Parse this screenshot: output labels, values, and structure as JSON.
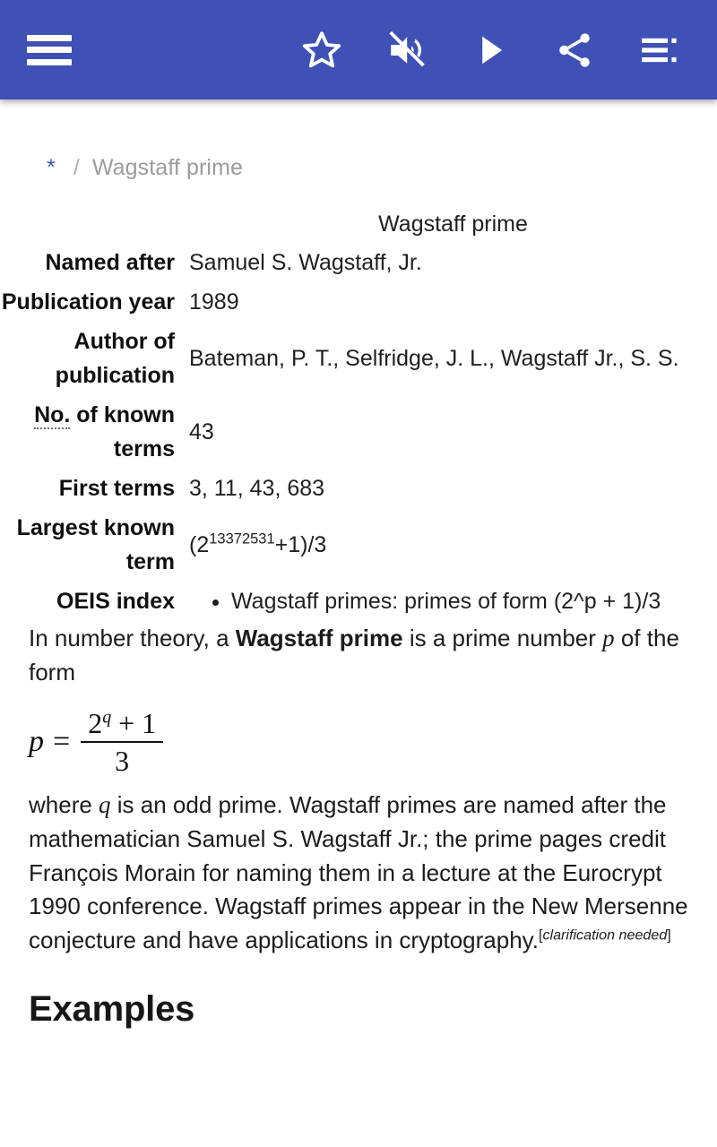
{
  "appbar": {
    "background_color": "#3f51b5",
    "menu_icon": "hamburger-menu-icon",
    "actions": [
      {
        "name": "favorite",
        "icon": "star-outline-icon",
        "label": "Favorite"
      },
      {
        "name": "mute",
        "icon": "volume-off-icon",
        "label": "Volume off"
      },
      {
        "name": "play",
        "icon": "play-icon",
        "label": "Play"
      },
      {
        "name": "share",
        "icon": "share-icon",
        "label": "Share"
      },
      {
        "name": "contents",
        "icon": "table-of-contents-icon",
        "label": "Contents"
      }
    ]
  },
  "breadcrumb": {
    "home": "*",
    "separator": "/",
    "current": "Wagstaff prime"
  },
  "infobox": {
    "title": "Wagstaff prime",
    "rows": [
      {
        "label": "Named after",
        "value": "Samuel S. Wagstaff, Jr."
      },
      {
        "label": "Publication year",
        "value": "1989"
      },
      {
        "label": "Author of publication",
        "value": "Bateman, P. T., Selfridge, J. L., Wagstaff Jr., S. S."
      },
      {
        "label_abbr": "No.",
        "label_rest": " of known terms",
        "label": "No. of known terms",
        "value": "43"
      },
      {
        "label": "First terms",
        "value": "3, 11, 43, 683"
      },
      {
        "label": "Largest known term",
        "value_pre": "(2",
        "value_sup": "13372531",
        "value_post": "+1)/3",
        "value": "(2^13372531+1)/3"
      },
      {
        "label": "OEIS index",
        "value": "Wagstaff primes: primes of form (2^p + 1)/3"
      }
    ]
  },
  "article": {
    "intro_1": "In number theory, a ",
    "intro_bold": "Wagstaff prime",
    "intro_2": " is a prime number ",
    "intro_var": "p",
    "intro_3": " of the form",
    "formula": {
      "lhs": "p",
      "equals": "=",
      "numerator_base": "2",
      "numerator_exp": "q",
      "numerator_rest": " + 1",
      "denominator": "3"
    },
    "body_1": "where ",
    "body_var": "q",
    "body_2": " is an odd prime. Wagstaff primes are named after the mathematician Samuel S. Wagstaff Jr.; the prime pages credit François Morain for naming them in a lecture at the Eurocrypt 1990 conference. Wagstaff primes appear in the New Mersenne conjecture and have applications in cryptography.",
    "clarification_open": "[",
    "clarification": "clarification needed",
    "clarification_close": "]"
  },
  "sections": {
    "examples_heading": "Examples"
  }
}
